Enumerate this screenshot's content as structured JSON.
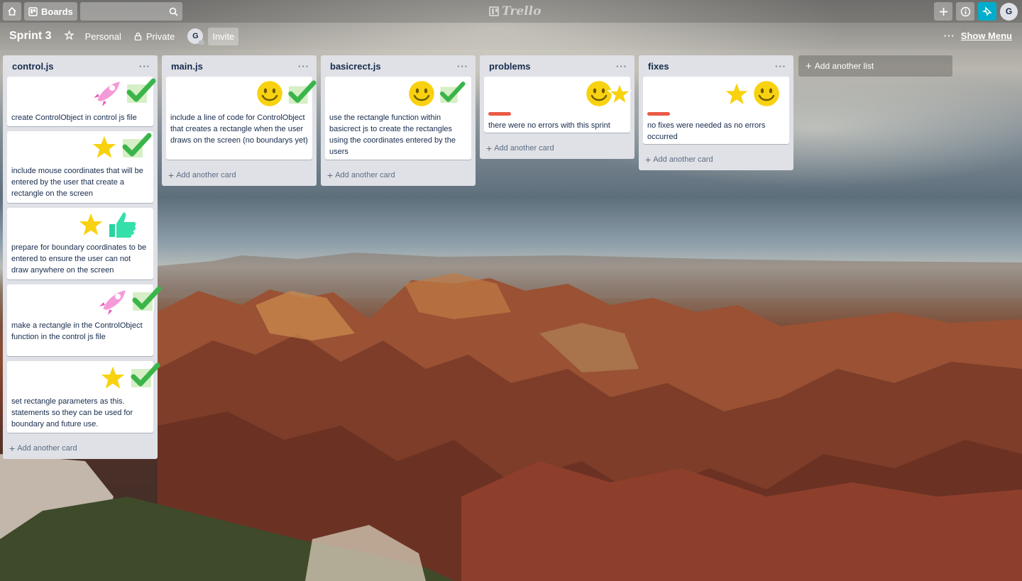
{
  "header": {
    "boards_label": "Boards",
    "logo_text": "Trello",
    "avatar_initial": "G"
  },
  "board": {
    "title": "Sprint 3",
    "team": "Personal",
    "visibility": "Private",
    "member_initial": "G",
    "invite_label": "Invite",
    "more_dots": "···",
    "show_menu_label": "Show Menu"
  },
  "lists": [
    {
      "title": "control.js",
      "menu": "···",
      "cards": [
        {
          "text": "create ControlObject in control js file",
          "stickers": [
            "rocket-sticker",
            "check-sticker"
          ]
        },
        {
          "text": "include mouse coordinates that will be entered by the user that create a rectangle on the screen",
          "stickers": [
            "star-sticker",
            "check-sticker"
          ]
        },
        {
          "text": "prepare for boundary coordinates to be entered to ensure the user can not draw anywhere on the screen",
          "stickers": [
            "star-sticker",
            "thumbs-up-sticker"
          ]
        },
        {
          "text": "make a rectangle in the ControlObject function in the control js file",
          "stickers": [
            "rocket-sticker",
            "check-sticker"
          ]
        },
        {
          "text": "set rectangle parameters as this. statements so they can be used for boundary and future use.",
          "stickers": [
            "star-sticker",
            "check-sticker"
          ]
        }
      ],
      "add_card": "Add another card"
    },
    {
      "title": "main.js",
      "menu": "···",
      "cards": [
        {
          "text": "include a line of code for ControlObject that creates a rectangle when the user draws on the screen (no boundarys yet)",
          "stickers": [
            "smile-sticker",
            "check-sticker"
          ]
        }
      ],
      "add_card": "Add another card"
    },
    {
      "title": "basicrect.js",
      "menu": "···",
      "cards": [
        {
          "text": "use the rectangle function within basicrect js to create the rectangles using the coordinates entered by the users",
          "stickers": [
            "smile-sticker",
            "check-sticker"
          ]
        }
      ],
      "add_card": "Add another card"
    },
    {
      "title": "problems",
      "menu": "···",
      "cards": [
        {
          "text": "there were no errors with this sprint",
          "label": "red",
          "stickers": [
            "smile-sticker",
            "star-sticker"
          ]
        }
      ],
      "add_card": "Add another card"
    },
    {
      "title": "fixes",
      "menu": "···",
      "cards": [
        {
          "text": "no fixes were needed as no errors occurred",
          "label": "red",
          "stickers": [
            "star-sticker",
            "smile-sticker"
          ]
        }
      ],
      "add_card": "Add another card"
    }
  ],
  "add_list_label": "Add another list",
  "colors": {
    "list_bg": "#dfe1e6",
    "label_red": "#eb5a46",
    "notify_blue": "#00aecc"
  }
}
